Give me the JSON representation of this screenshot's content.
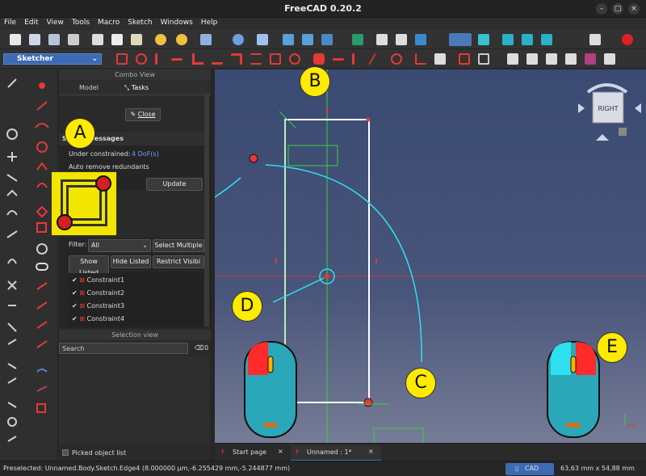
{
  "window": {
    "title": "FreeCAD 0.20.2",
    "buttons": [
      "–",
      "□",
      "×"
    ]
  },
  "menu": [
    "File",
    "Edit",
    "View",
    "Tools",
    "Macro",
    "Sketch",
    "Windows",
    "Help"
  ],
  "workbench": {
    "selected": "Sketcher"
  },
  "combo": {
    "header": "Combo View",
    "tabs": [
      "Model",
      "Tasks"
    ],
    "close_label": "Close",
    "messages_title": "Solver messages",
    "under_constrained": "Under constrained:",
    "dof_link": "4 DoF(s)",
    "redundants": "Auto remove redundants",
    "update_label": "Update",
    "filter_label": "Filter:",
    "filter_value": "All",
    "select_multiple": "Select Multiple",
    "show_listed": "Show Listed",
    "hide_listed": "Hide Listed",
    "restrict_visib": "Restrict Visibi",
    "constraints": [
      "Constraint1",
      "Constraint2",
      "Constraint3",
      "Constraint4"
    ]
  },
  "selection_view": {
    "header": "Selection view",
    "search_placeholder": "Search",
    "count": "0",
    "picked_list": "Picked object list"
  },
  "navcube": {
    "face": "RIGHT"
  },
  "labels": [
    "A",
    "B",
    "C",
    "D",
    "E"
  ],
  "doc_tabs": [
    {
      "label": "Start page"
    },
    {
      "label": "Unnamed : 1*"
    }
  ],
  "status": {
    "preselected": "Preselected: Unnamed.Body.Sketch.Edge4 (8.000000 µm,-6.255429 mm,-5.244877 mm)",
    "nav_style": "CAD",
    "dimensions": "63,63 mm x 54,88 mm"
  },
  "colors": {
    "accent_blue": "#3d6bb3",
    "highlight_yellow": "#ffeb00",
    "sketch_red": "#e53935",
    "arrow_cyan": "#2ee0f0"
  }
}
